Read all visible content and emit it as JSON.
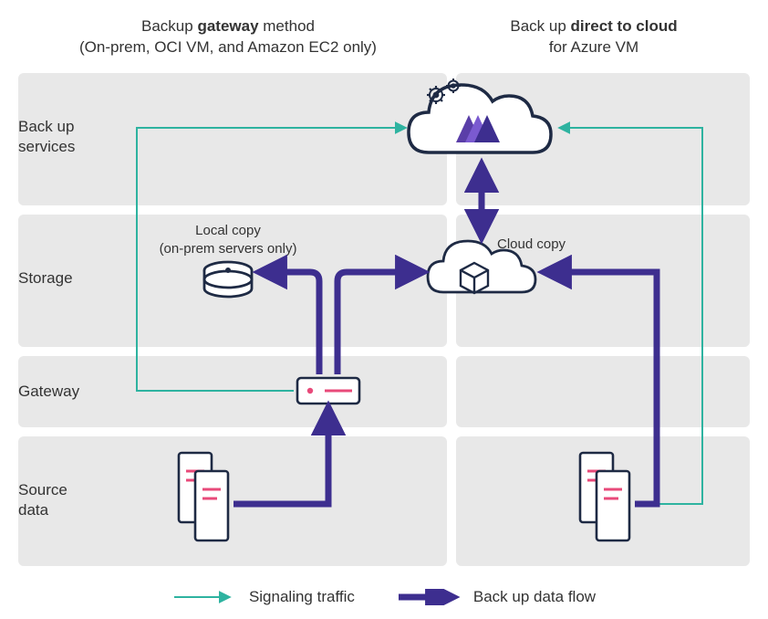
{
  "headers": {
    "left": {
      "prefix": "Backup ",
      "bold": "gateway",
      "suffix": " method",
      "sub": "(On-prem, OCI VM, and Amazon EC2 only)"
    },
    "right": {
      "prefix": "Back up ",
      "bold": "direct to cloud",
      "sub": "for Azure VM"
    }
  },
  "rows": {
    "services": "Back up services",
    "storage": "Storage",
    "gateway": "Gateway",
    "source": "Source data"
  },
  "annotations": {
    "local_copy_line1": "Local copy",
    "local_copy_line2": "(on-prem servers only)",
    "cloud_copy": "Cloud copy"
  },
  "legend": {
    "signaling": "Signaling traffic",
    "dataflow": "Back up data flow"
  },
  "chart_data": {
    "type": "diagram",
    "description": "Backup architecture showing two methods: gateway-based backup (on-prem, OCI VM, Amazon EC2) and direct-to-cloud backup (Azure VM), across four layers.",
    "layers": [
      "Back up services",
      "Storage",
      "Gateway",
      "Source data"
    ],
    "columns": [
      {
        "name": "Backup gateway method",
        "applies_to": "On-prem, OCI VM, and Amazon EC2 only"
      },
      {
        "name": "Back up direct to cloud",
        "applies_to": "Azure VM"
      }
    ],
    "nodes": [
      {
        "id": "backup_services_cloud",
        "label": "Back up services cloud",
        "layer": "Back up services"
      },
      {
        "id": "local_copy",
        "label": "Local copy (on-prem servers only)",
        "layer": "Storage",
        "column": 0
      },
      {
        "id": "cloud_copy",
        "label": "Cloud copy",
        "layer": "Storage"
      },
      {
        "id": "gateway",
        "label": "Gateway appliance",
        "layer": "Gateway",
        "column": 0
      },
      {
        "id": "source_left",
        "label": "Source servers (left)",
        "layer": "Source data",
        "column": 0
      },
      {
        "id": "source_right",
        "label": "Source servers (right)",
        "layer": "Source data",
        "column": 1
      }
    ],
    "edges": [
      {
        "from": "source_left",
        "to": "gateway",
        "type": "data",
        "direction": "forward"
      },
      {
        "from": "gateway",
        "to": "local_copy",
        "type": "data",
        "direction": "forward"
      },
      {
        "from": "gateway",
        "to": "cloud_copy",
        "type": "data",
        "direction": "forward"
      },
      {
        "from": "cloud_copy",
        "to": "backup_services_cloud",
        "type": "data",
        "direction": "bidirectional"
      },
      {
        "from": "source_right",
        "to": "cloud_copy",
        "type": "data",
        "direction": "forward"
      },
      {
        "from": "gateway",
        "to": "backup_services_cloud",
        "type": "signaling",
        "direction": "forward"
      },
      {
        "from": "source_right",
        "to": "backup_services_cloud",
        "type": "signaling",
        "direction": "forward"
      }
    ],
    "legend": [
      {
        "style": "thin teal arrow",
        "meaning": "Signaling traffic"
      },
      {
        "style": "thick purple arrow",
        "meaning": "Back up data flow"
      }
    ]
  }
}
